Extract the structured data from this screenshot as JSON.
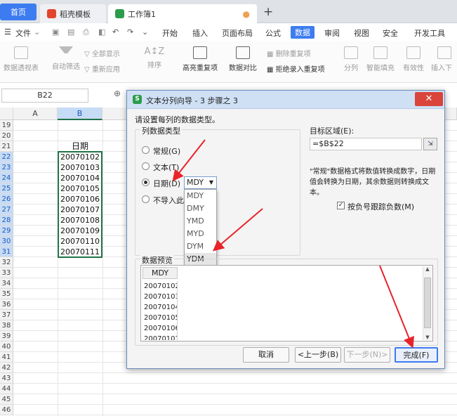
{
  "tabs": {
    "home": "首页",
    "template": "稻壳模板",
    "workbook": "工作簿1"
  },
  "menu": {
    "file": "文件",
    "items": [
      "开始",
      "插入",
      "页面布局",
      "公式",
      "数据",
      "审阅",
      "视图",
      "安全",
      "开发工具"
    ],
    "active_index": 4
  },
  "ribbon": {
    "pivot": "数据透视表",
    "autofilter": "自动筛选",
    "showall": "全部显示",
    "reapply": "重新应用",
    "sort": "排序",
    "highlight_dup": "高亮重复项",
    "data_compare": "数据对比",
    "delete_dup": "删除重复项",
    "reject_dup": "拒绝录入重复项",
    "split": "分列",
    "smart_fill": "智能填充",
    "validity": "有效性",
    "insert_dropdown": "插入下"
  },
  "namebox": "B22",
  "grid": {
    "columns": [
      "A",
      "B"
    ],
    "rows": [
      "19",
      "20",
      "21",
      "22",
      "23",
      "24",
      "25",
      "26",
      "27",
      "28",
      "29",
      "30",
      "31",
      "32",
      "33",
      "34",
      "35",
      "36",
      "37",
      "38",
      "39",
      "40",
      "41",
      "42",
      "43",
      "44",
      "45",
      "46"
    ],
    "header_cell": "日期",
    "cells": [
      "20070102",
      "20070103",
      "20070104",
      "20070105",
      "20070106",
      "20070107",
      "20070108",
      "20070109",
      "20070110",
      "20070111"
    ]
  },
  "dialog": {
    "title": "文本分列向导 - 3 步骤之 3",
    "close": "✕",
    "instruction": "请设置每列的数据类型。",
    "group_label": "列数据类型",
    "radios": [
      "常规(G)",
      "文本(T)",
      "日期(D)",
      "不导入此列"
    ],
    "date_format": "MDY",
    "dropdown_options": [
      "MDY",
      "DMY",
      "YMD",
      "MYD",
      "DYM",
      "YDM"
    ],
    "dropdown_highlight": 5,
    "target_label": "目标区域(E):",
    "target_value": "=$B$22",
    "range_btn": "⇲",
    "note": "\"常规\"数据格式将数值转换成数字，日期值会转换为日期，其余数据则转换成文本。",
    "checkbox_label": "按负号跟踪负数(M)",
    "checkbox_mark": "✓",
    "preview_label": "数据预览",
    "preview_header": "MDY",
    "preview_rows": [
      "20070102",
      "20070103",
      "20070104",
      "20070105",
      "20070106",
      "20070107",
      "20070108"
    ],
    "buttons": {
      "cancel": "取消",
      "back": "<上一步(B)",
      "next": "下一步(N)>",
      "finish": "完成(F)"
    }
  },
  "colors": {
    "accent": "#3d7cf0",
    "excel_green": "#217346",
    "arrow_red": "#e8232a",
    "close_red": "#d9443b"
  }
}
